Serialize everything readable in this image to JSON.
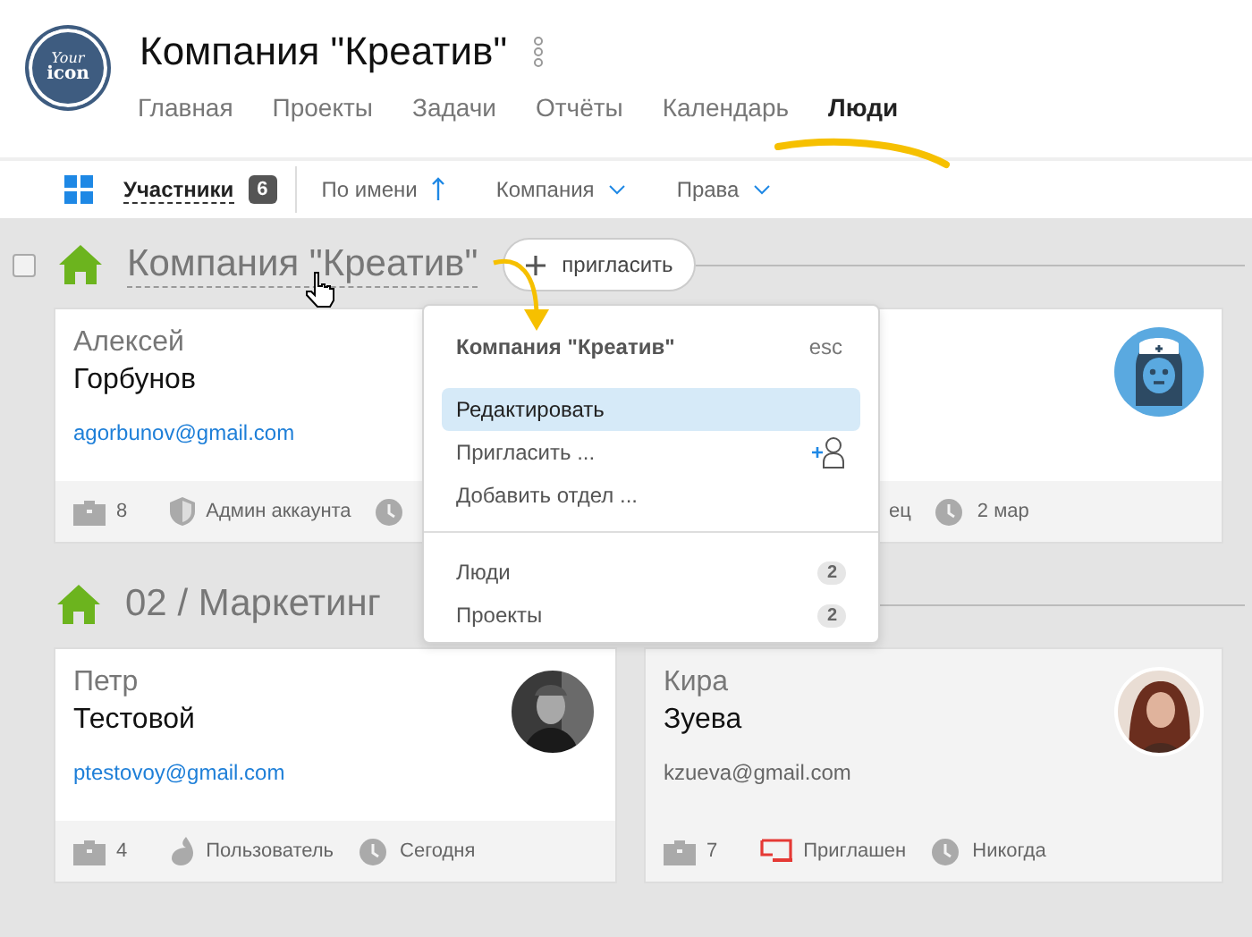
{
  "header": {
    "logo_text": [
      "Your",
      "icon"
    ],
    "title": "Компания \"Креатив\"",
    "nav": [
      {
        "label": "Главная",
        "selected": false
      },
      {
        "label": "Проекты",
        "selected": false
      },
      {
        "label": "Задачи",
        "selected": false
      },
      {
        "label": "Отчёты",
        "selected": false
      },
      {
        "label": "Календарь",
        "selected": false
      },
      {
        "label": "Люди",
        "selected": true
      }
    ]
  },
  "toolbar": {
    "members": {
      "label": "Участники",
      "count": "6"
    },
    "filters": [
      {
        "label": "По имени",
        "kind": "sort"
      },
      {
        "label": "Компания",
        "kind": "dropdown"
      },
      {
        "label": "Права",
        "kind": "dropdown"
      }
    ]
  },
  "groups": [
    {
      "checkbox": {
        "checked": false
      },
      "title": "Компания \"Креатив\"",
      "invite_label": "пригласить",
      "members": [
        {
          "first": "Алексей",
          "last": "Горбунов",
          "email": "agorbunov@gmail.com",
          "active": true,
          "projects": "8",
          "role": {
            "kind": "admin",
            "label": "Админ аккаунта"
          }
        },
        {
          "active": true,
          "avatar": {
            "kind": "nurse"
          },
          "role": {
            "kind": "hidden",
            "label": "ец"
          },
          "last_seen": "2 мар"
        }
      ]
    },
    {
      "title": "02 / Маркетинг",
      "members": [
        {
          "first": "Петр",
          "last": "Тестовой",
          "email": "ptestovoy@gmail.com",
          "active": true,
          "projects": "4",
          "role": {
            "kind": "user",
            "label": "Пользователь"
          },
          "last_seen": "Сегодня"
        },
        {
          "first": "Кира",
          "last": "Зуева",
          "email": "kzueva@gmail.com",
          "active": false,
          "projects": "7",
          "role": {
            "kind": "invited",
            "label": "Приглашен"
          },
          "last_seen": "Никогда"
        }
      ]
    }
  ],
  "popup": {
    "title": "Компания \"Креатив\"",
    "shortcut": "esc",
    "actions": [
      {
        "label": "Редактировать",
        "selected": true,
        "kind": "plain"
      },
      {
        "label": "Пригласить ...",
        "selected": false,
        "kind": "invite"
      },
      {
        "label": "Добавить отдел ...",
        "selected": false,
        "kind": "plain"
      }
    ],
    "counts": [
      {
        "label": "Люди",
        "count": "2"
      },
      {
        "label": "Проекты",
        "count": "2"
      }
    ]
  }
}
